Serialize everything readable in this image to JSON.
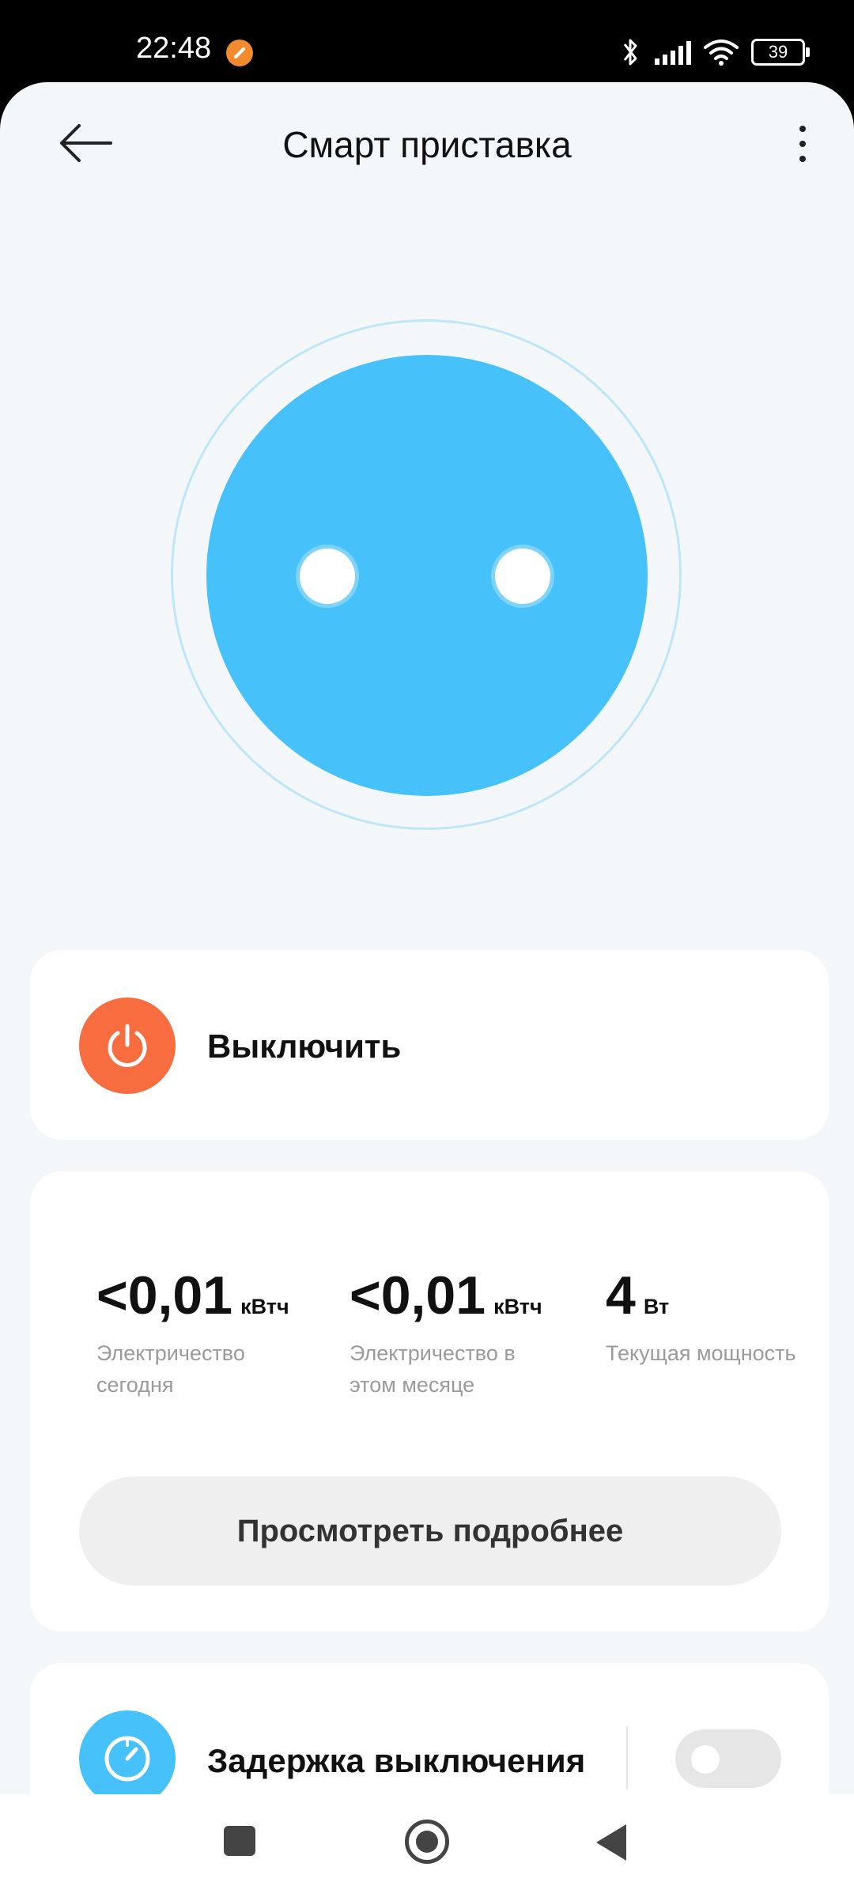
{
  "status_bar": {
    "time": "22:48",
    "battery": "39",
    "icons": [
      "app-notification-icon",
      "bluetooth-icon",
      "signal-icon",
      "wifi-icon",
      "battery-icon"
    ]
  },
  "header": {
    "title": "Смарт приставка",
    "back_icon": "arrow-left-icon",
    "more_icon": "more-vertical-icon"
  },
  "socket": {
    "face_color": "#46c1f9",
    "ring_color": "#bfe6f6"
  },
  "power": {
    "label": "Выключить",
    "icon": "power-icon",
    "color": "#f86d3f"
  },
  "stats": {
    "items": [
      {
        "value": "<0,01",
        "unit": "кВтч",
        "label": "Электричество сегодня"
      },
      {
        "value": "<0,01",
        "unit": "кВтч",
        "label": "Электричество в этом месяце"
      },
      {
        "value": "4",
        "unit": "Вт",
        "label": "Текущая мощность"
      }
    ],
    "details_button": "Просмотреть подробнее"
  },
  "delay_off": {
    "label": "Задержка выключения",
    "icon": "timer-icon",
    "enabled": false
  },
  "nav_bar": {
    "icons": [
      "recents-icon",
      "home-icon",
      "back-icon"
    ]
  }
}
